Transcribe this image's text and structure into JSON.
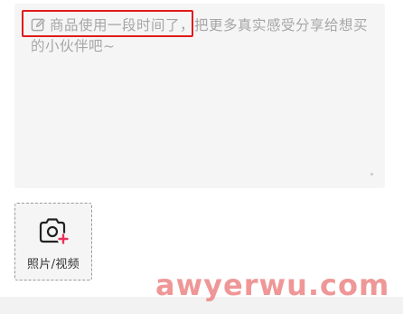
{
  "review": {
    "placeholder_highlighted": "商品使用一段时间了，",
    "placeholder_rest": "把更多真实感受分享给想买的小伙伴吧~",
    "edit_icon": "edit-icon"
  },
  "media_upload": {
    "icon": "camera-plus-icon",
    "label": "照片/视频",
    "accent_color": "#e8325a"
  },
  "annotation": {
    "highlight_color": "#e01b1b"
  },
  "watermark": {
    "text": "awyerwu.com"
  }
}
